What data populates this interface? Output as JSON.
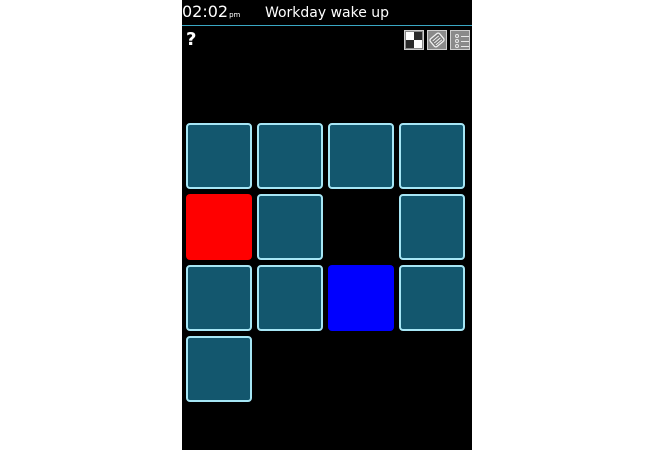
{
  "status_bar": {
    "time": "02:02",
    "ampm": "pm",
    "title": "Workday wake up"
  },
  "help": {
    "label": "?"
  },
  "toolbar": {
    "icons": [
      "checkerboard-icon",
      "skin-icon",
      "level-select-icon"
    ]
  },
  "colors": {
    "background": "#000000",
    "tile_fill": "#13576e",
    "tile_border": "#a6e6f5",
    "red": "#ff0000",
    "blue": "#0000ff",
    "divider": "#3aa7c4"
  },
  "board": {
    "columns": 4,
    "rows": 4,
    "cells": [
      "tile",
      "tile",
      "tile",
      "tile",
      "red",
      "tile",
      "empty",
      "tile",
      "tile",
      "tile",
      "blue",
      "tile",
      "tile",
      "empty",
      "empty",
      "empty"
    ]
  }
}
